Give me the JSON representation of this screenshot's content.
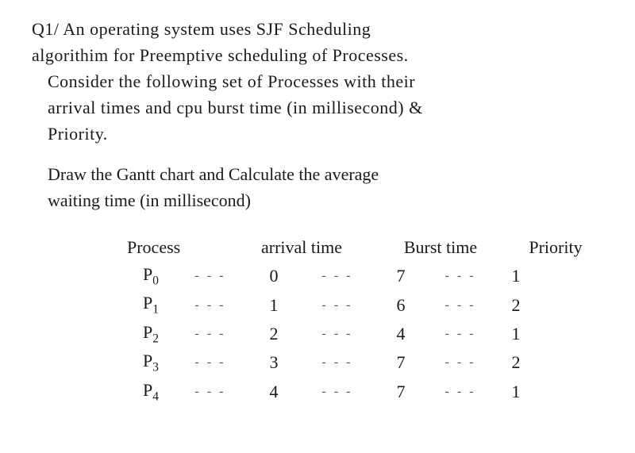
{
  "question": {
    "label": "Q1/",
    "line1": "An operating system uses SJF Scheduling",
    "line2": "algorithim for Preemptive scheduling of Processes.",
    "line3": "Consider the following set of Processes with their",
    "line4": "arrival times and cpu burst time (in millisecond) &",
    "line5": "Priority."
  },
  "task": {
    "line1": "Draw the Gantt chart and Calculate the average",
    "line2": "waiting time (in millisecond)"
  },
  "table": {
    "headers": {
      "process": "Process",
      "arrival": "arrival time",
      "burst": "Burst time",
      "priority": "Priority"
    },
    "rows": [
      {
        "process": "P",
        "sub": "0",
        "arrival": "0",
        "burst": "7",
        "priority": "1"
      },
      {
        "process": "P",
        "sub": "1",
        "arrival": "1",
        "burst": "6",
        "priority": "2"
      },
      {
        "process": "P",
        "sub": "2",
        "arrival": "2",
        "burst": "4",
        "priority": "1"
      },
      {
        "process": "P",
        "sub": "3",
        "arrival": "3",
        "burst": "7",
        "priority": "2"
      },
      {
        "process": "P",
        "sub": "4",
        "arrival": "4",
        "burst": "7",
        "priority": "1"
      }
    ]
  },
  "dash_pattern": "- - -"
}
